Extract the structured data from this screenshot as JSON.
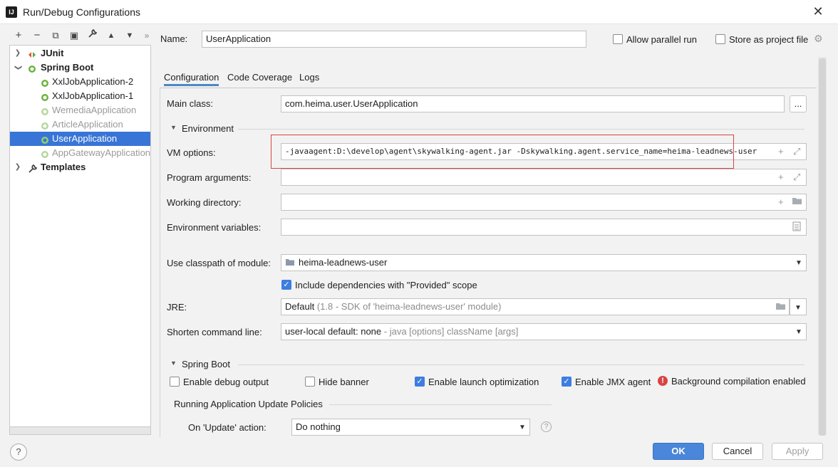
{
  "window": {
    "title": "Run/Debug Configurations",
    "app_icon": "IJ"
  },
  "toolbar": {
    "add": "+",
    "remove": "−",
    "copy": "⧉",
    "save": "▣",
    "wrench": "🔧",
    "up": "▲",
    "down": "▼",
    "more": "»"
  },
  "tree": {
    "items": [
      {
        "label": "JUnit",
        "icon": "junit-icon"
      },
      {
        "label": "Spring Boot",
        "icon": "spring-boot-icon"
      },
      {
        "label": "XxlJobApplication-2",
        "icon": "spring-boot-app-icon"
      },
      {
        "label": "XxlJobApplication-1",
        "icon": "spring-boot-app-icon"
      },
      {
        "label": "WemediaApplication",
        "icon": "spring-boot-app-icon"
      },
      {
        "label": "ArticleApplication",
        "icon": "spring-boot-app-icon"
      },
      {
        "label": "UserApplication",
        "icon": "spring-boot-app-icon"
      },
      {
        "label": "AppGatewayApplication",
        "icon": "spring-boot-app-icon"
      },
      {
        "label": "Templates",
        "icon": "wrench-icon"
      }
    ]
  },
  "header": {
    "name_label": "Name:",
    "name_value": "UserApplication",
    "allow_parallel_run": "Allow parallel run",
    "store_as_project_file": "Store as project file"
  },
  "tabs": [
    "Configuration",
    "Code Coverage",
    "Logs"
  ],
  "config": {
    "main_class_label": "Main class:",
    "main_class_value": "com.heima.user.UserApplication",
    "ellipsis": "...",
    "environment_section": "Environment",
    "vm_options_label": "VM options:",
    "vm_options_value": "-javaagent:D:\\develop\\agent\\skywalking-agent.jar -Dskywalking.agent.service_name=heima-leadnews-user",
    "program_args_label": "Program arguments:",
    "working_dir_label": "Working directory:",
    "env_vars_label": "Environment variables:",
    "classpath_label": "Use classpath of module:",
    "classpath_value": "heima-leadnews-user",
    "include_provided": "Include dependencies with \"Provided\" scope",
    "jre_label": "JRE:",
    "jre_value": "Default",
    "jre_hint": "(1.8 - SDK of 'heima-leadnews-user' module)",
    "shorten_label": "Shorten command line:",
    "shorten_value": "user-local default: none",
    "shorten_hint": "- java [options] className [args]",
    "spring_boot_section": "Spring Boot",
    "enable_debug_output": "Enable debug output",
    "hide_banner": "Hide banner",
    "enable_launch_opt": "Enable launch optimization",
    "enable_jmx": "Enable JMX agent",
    "background_compilation": "Background compilation enabled",
    "update_policies": "Running Application Update Policies",
    "on_update_label": "On 'Update' action:",
    "on_update_value": "Do nothing"
  },
  "buttons": {
    "ok": "OK",
    "cancel": "Cancel",
    "apply": "Apply",
    "help": "?"
  },
  "colors": {
    "selection": "#3875d7",
    "accent": "#4a86d9",
    "highlight_box": "#d94444"
  }
}
